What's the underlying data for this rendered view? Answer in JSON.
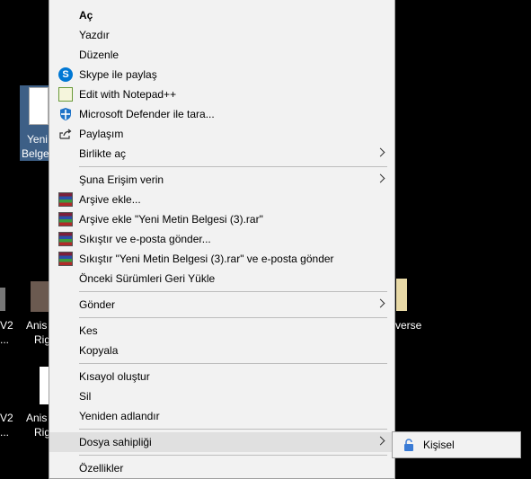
{
  "desktop": {
    "icon_label_partial_1": "Yeni",
    "icon_label_partial_2": "Belge",
    "left_text_1": "V2",
    "left_text_2": "...",
    "left_text_3": "V2",
    "left_text_4": "...",
    "anis_1": "Anis",
    "rig_1": "Rig",
    "anis_2": "Anis",
    "rig_2": "Rig",
    "verse": "verse"
  },
  "menu": {
    "open": "Aç",
    "print": "Yazdır",
    "edit": "Düzenle",
    "skype": "Skype ile paylaş",
    "notepad": "Edit with Notepad++",
    "defender": "Microsoft Defender ile tara...",
    "share": "Paylaşım",
    "open_with": "Birlikte aç",
    "give_access": "Şuna Erişim verin",
    "add_archive": "Arşive ekle...",
    "add_archive_named": "Arşive ekle \"Yeni Metin Belgesi (3).rar\"",
    "compress_email": "Sıkıştır ve e-posta gönder...",
    "compress_named_email": "Sıkıştır \"Yeni Metin Belgesi (3).rar\" ve e-posta gönder",
    "restore": "Önceki Sürümleri Geri Yükle",
    "send_to": "Gönder",
    "cut": "Kes",
    "copy": "Kopyala",
    "shortcut": "Kısayol oluştur",
    "delete": "Sil",
    "rename": "Yeniden adlandır",
    "ownership": "Dosya sahipliği",
    "properties": "Özellikler"
  },
  "submenu": {
    "personal": "Kişisel"
  },
  "colors": {
    "menu_bg": "#f2f2f2",
    "highlight": "#e0e0e0",
    "skype": "#0078d4",
    "defender": "#1e73c8"
  }
}
